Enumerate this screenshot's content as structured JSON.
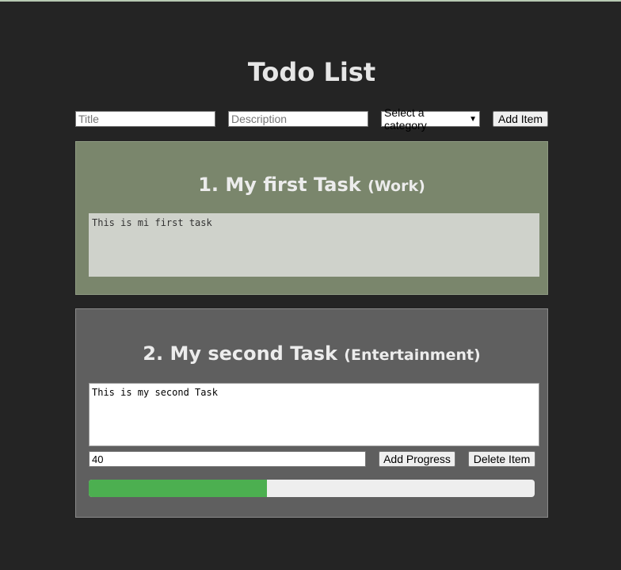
{
  "page": {
    "title": "Todo List"
  },
  "form": {
    "title_placeholder": "Title",
    "description_placeholder": "Description",
    "category_selected": "Select a category",
    "add_button": "Add Item"
  },
  "items": [
    {
      "number": "1.",
      "title": "My first Task",
      "category": "(Work)",
      "description": "This is mi first task"
    },
    {
      "number": "2.",
      "title": "My second Task",
      "category": "(Entertainment)",
      "description": "This is my second Task",
      "progress_value": "40",
      "progress_percent": 40,
      "add_progress_button": "Add Progress",
      "delete_button": "Delete Item"
    }
  ],
  "colors": {
    "background": "#242424",
    "card_work": "#7a866c",
    "card_entertainment": "#5f5f5f",
    "progress_fill": "#4caf50"
  }
}
